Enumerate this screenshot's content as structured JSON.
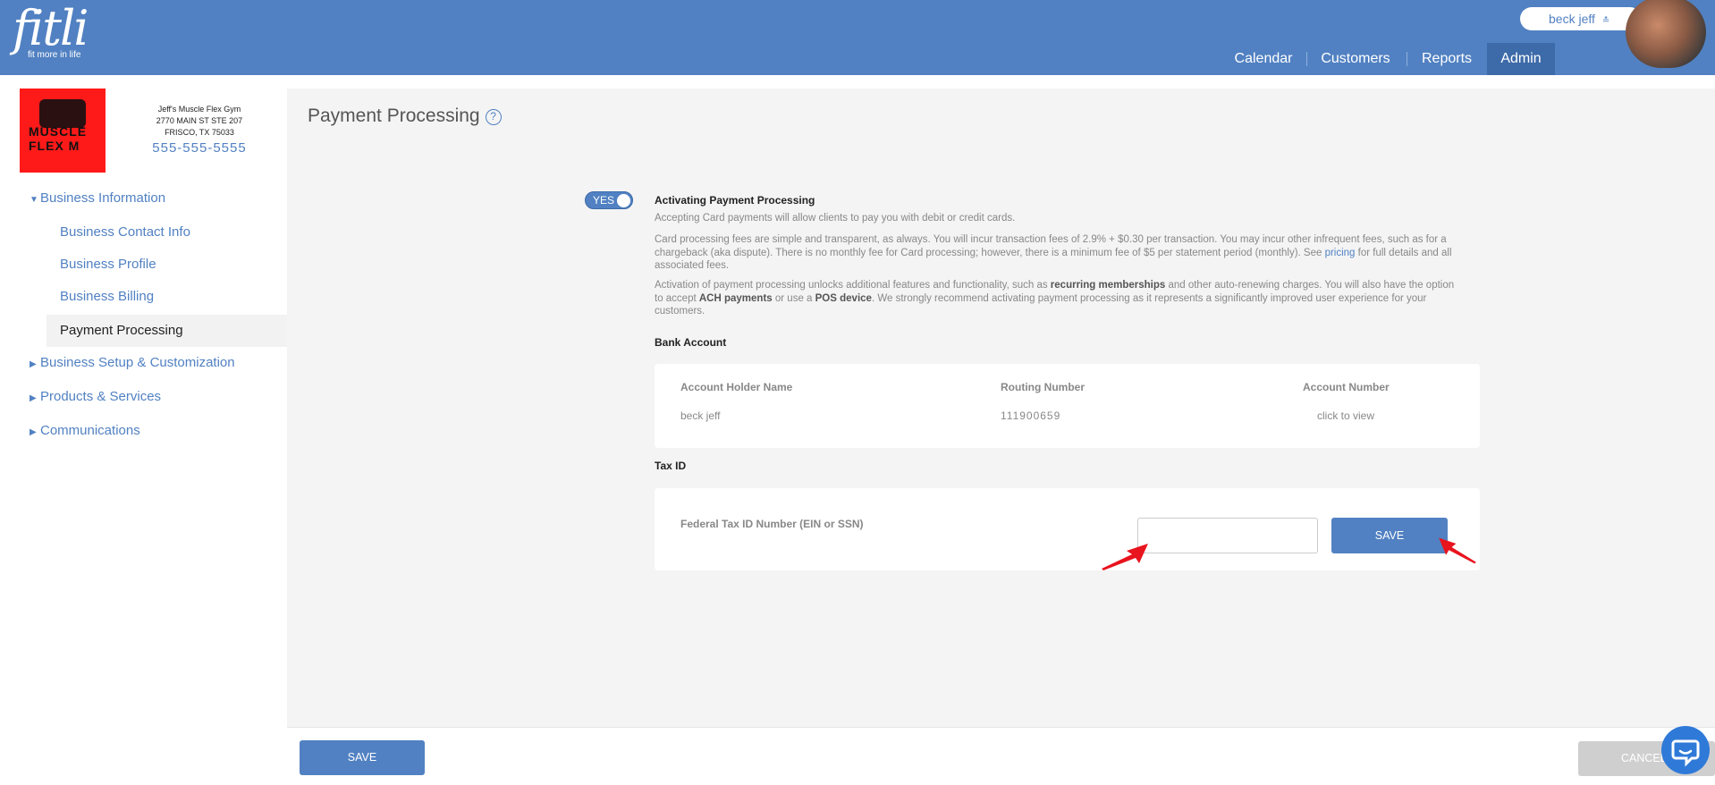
{
  "header": {
    "logo": "fitli",
    "tagline": "fit more in life",
    "user_name": "beck jeff",
    "user_chevron": "double-chevron-down-icon",
    "nav": [
      "Calendar",
      "Customers",
      "Reports",
      "Admin"
    ],
    "active_nav": "Admin"
  },
  "business": {
    "name": "Jeff's Muscle Flex Gym",
    "address1": "2770 MAIN ST STE 207",
    "address2": "FRISCO, TX 75033",
    "phone": "555-555-5555",
    "logo_text": "MUSCLE FLEX M"
  },
  "sidebar": {
    "items": [
      {
        "label": "Business Information",
        "expanded": true
      },
      {
        "label": "Business Setup & Customization",
        "expanded": false
      },
      {
        "label": "Products & Services",
        "expanded": false
      },
      {
        "label": "Communications",
        "expanded": false
      }
    ],
    "sub_items": [
      "Business Contact Info",
      "Business Profile",
      "Business Billing",
      "Payment Processing"
    ],
    "active_sub": "Payment Processing"
  },
  "page": {
    "title": "Payment Processing",
    "help_icon": "?"
  },
  "payments": {
    "toggle_label": "YES",
    "heading": "Activating Payment Processing",
    "para1": "Accepting Card payments will allow clients to pay you with debit or credit cards.",
    "para2_a": "Card processing fees are simple and transparent, as always. You will incur transaction fees of 2.9% + $0.30 per transaction. You may incur other infrequent fees, such as for a chargeback (aka dispute). There is no monthly fee for Card processing; however, there is a minimum fee of $5 per statement period (monthly). See ",
    "para2_link": "pricing",
    "para2_b": " for full details and all associated fees.",
    "para3_a": "Activation of payment processing unlocks additional features and functionality, such as ",
    "para3_b1": "recurring memberships",
    "para3_c": " and other auto-renewing charges. You will also have the option to accept ",
    "para3_b2": "ACH payments",
    "para3_d": " or use a ",
    "para3_b3": "POS device",
    "para3_e": ". We strongly recommend activating payment processing as it represents a significantly improved user experience for your customers."
  },
  "bank": {
    "heading": "Bank Account",
    "col_holder": "Account Holder Name",
    "col_routing": "Routing Number",
    "col_account": "Account Number",
    "holder": "beck jeff",
    "routing": "111900659",
    "account_link": "click to view"
  },
  "tax": {
    "heading": "Tax ID",
    "label": "Federal Tax ID Number (EIN or SSN)",
    "value": "",
    "placeholder": "",
    "save_label": "SAVE"
  },
  "footer": {
    "save_label": "SAVE",
    "cancel_label": "CANCEL"
  },
  "colors": {
    "brand": "#5181c2",
    "annotation_arrow": "#e8141e"
  }
}
